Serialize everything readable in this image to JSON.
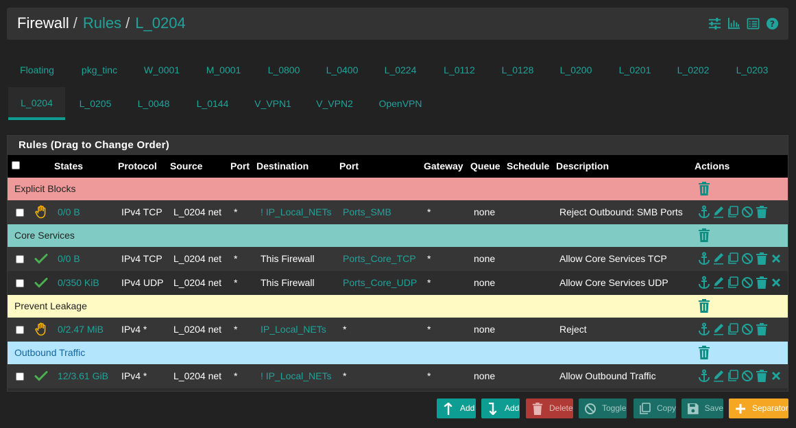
{
  "breadcrumb": {
    "first": "Firewall",
    "second": "Rules",
    "third": "L_0204",
    "separator": "/"
  },
  "header_icons": [
    "sliders-icon",
    "bar-chart-icon",
    "list-icon",
    "help-icon"
  ],
  "tabs_row1": [
    "Floating",
    "pkg_tinc",
    "W_0001",
    "M_0001",
    "L_0800",
    "L_0400",
    "L_0224",
    "L_0112",
    "L_0128",
    "L_0200",
    "L_0201",
    "L_0202",
    "L_0203"
  ],
  "tabs_row2": [
    "L_0204",
    "L_0205",
    "L_0048",
    "L_0144",
    "V_VPN1",
    "V_VPN2",
    "OpenVPN"
  ],
  "active_tab": "L_0204",
  "panel": {
    "title": "Rules (Drag to Change Order)"
  },
  "columns": {
    "states": "States",
    "protocol": "Protocol",
    "source": "Source",
    "port": "Port",
    "destination": "Destination",
    "dport": "Port",
    "gateway": "Gateway",
    "queue": "Queue",
    "schedule": "Schedule",
    "description": "Description",
    "actions": "Actions"
  },
  "separators": {
    "s1": "Explicit Blocks",
    "s2": "Core Services",
    "s3": "Prevent Leakage",
    "s4": "Outbound Traffic"
  },
  "rules": {
    "r1": {
      "action": "reject",
      "states": "0/0 B",
      "protocol": "IPv4 TCP",
      "source": "L_0204 net",
      "port": "*",
      "destination": "! IP_Local_NETs",
      "dport": "Ports_SMB",
      "gateway": "*",
      "queue": "none",
      "schedule": "",
      "description": "Reject Outbound: SMB Ports"
    },
    "r2": {
      "action": "pass",
      "states": "0/0 B",
      "protocol": "IPv4 TCP",
      "source": "L_0204 net",
      "port": "*",
      "destination": "This Firewall",
      "dport": "Ports_Core_TCP",
      "gateway": "*",
      "queue": "none",
      "schedule": "",
      "description": "Allow Core Services TCP"
    },
    "r3": {
      "action": "pass",
      "states": "0/350 KiB",
      "protocol": "IPv4 UDP",
      "source": "L_0204 net",
      "port": "*",
      "destination": "This Firewall",
      "dport": "Ports_Core_UDP",
      "gateway": "*",
      "queue": "none",
      "schedule": "",
      "description": "Allow Core Services UDP"
    },
    "r4": {
      "action": "reject",
      "states": "0/2.47 MiB",
      "protocol": "IPv4 *",
      "source": "L_0204 net",
      "port": "*",
      "destination": "IP_Local_NETs",
      "dport": "*",
      "gateway": "*",
      "queue": "none",
      "schedule": "",
      "description": "Reject"
    },
    "r5": {
      "action": "pass",
      "states": "12/3.61 GiB",
      "protocol": "IPv4 *",
      "source": "L_0204 net",
      "port": "*",
      "destination": "! IP_Local_NETs",
      "dport": "*",
      "gateway": "*",
      "queue": "none",
      "schedule": "",
      "description": "Allow Outbound Traffic"
    }
  },
  "buttons": {
    "add_top": "Add",
    "add_bottom": "Add",
    "delete": "Delete",
    "toggle": "Toggle",
    "copy": "Copy",
    "save": "Save",
    "separator": "Separator"
  },
  "colors": {
    "accent": "#1fa39a",
    "sep_red": "#ef9a9a",
    "sep_teal": "#80cbc4",
    "sep_yellow": "#fff9c4",
    "sep_blue": "#b3e5fc",
    "pass": "#4caf50",
    "reject": "#f5b300",
    "separator_button": "#f5a623"
  }
}
